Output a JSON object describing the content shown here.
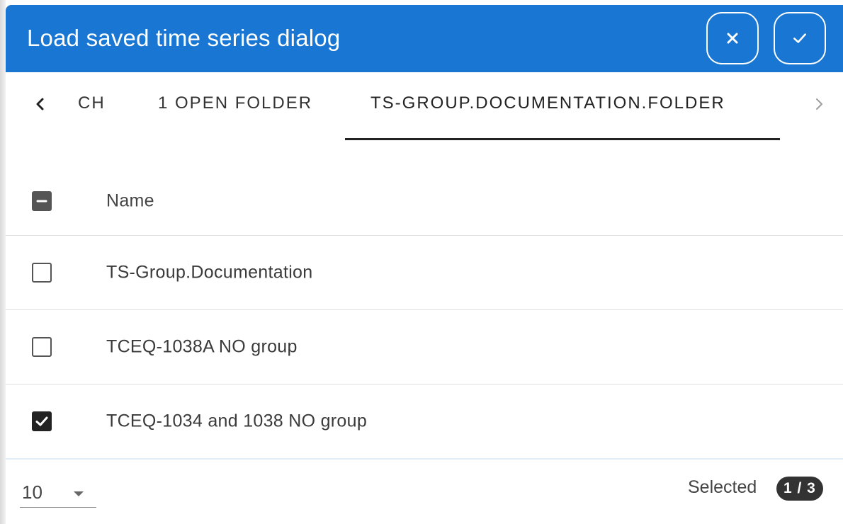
{
  "dialog": {
    "title": "Load saved time series dialog",
    "close_icon": "close-icon",
    "confirm_icon": "check-icon",
    "header_color": "#1976d2"
  },
  "tabs": {
    "items": [
      {
        "label": "CH"
      },
      {
        "label": "1 OPEN FOLDER"
      },
      {
        "label": "TS-GROUP.DOCUMENTATION.FOLDER",
        "active": true
      }
    ],
    "prev_icon": "chevron-left-icon",
    "next_icon": "chevron-right-icon"
  },
  "table": {
    "header": {
      "name_label": "Name",
      "select_all_state": "indeterminate"
    },
    "rows": [
      {
        "name": "TS-Group.Documentation",
        "checked": false
      },
      {
        "name": "TCEQ-1038A NO group",
        "checked": false
      },
      {
        "name": "TCEQ-1034 and 1038 NO group",
        "checked": true
      }
    ]
  },
  "footer": {
    "page_size": "10",
    "selected_label": "Selected",
    "selected_count": "1 / 3"
  }
}
